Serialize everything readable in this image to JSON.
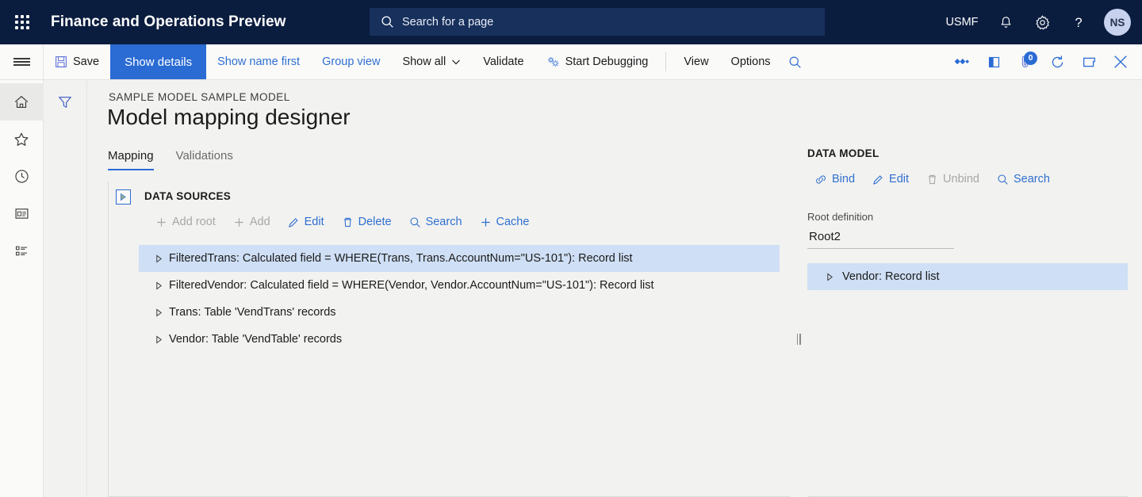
{
  "topbar": {
    "waffle_label": "app-launcher",
    "brand": "Finance and Operations Preview",
    "search_placeholder": "Search for a page",
    "company": "USMF",
    "notifications_icon": "bell-icon",
    "settings_icon": "gear-icon",
    "help_icon": "question-mark-icon",
    "avatar_initials": "NS"
  },
  "toolbar": {
    "save_label": "Save",
    "show_details_label": "Show details",
    "show_name_first_label": "Show name first",
    "group_view_label": "Group view",
    "show_all_label": "Show all",
    "validate_label": "Validate",
    "start_debugging_label": "Start Debugging",
    "view_label": "View",
    "options_label": "Options",
    "search_icon": "search-icon",
    "right_icons": {
      "related_icon": "diamond-cluster-icon",
      "panel_icon": "side-panel-icon",
      "attachments_icon": "attachment-icon",
      "attachments_badge": "0",
      "refresh_icon": "refresh-icon",
      "popout_icon": "open-in-new-window-icon",
      "close_icon": "close-icon"
    }
  },
  "rail": {
    "hamburger": "navigation-menu-icon",
    "items": [
      {
        "name": "home",
        "icon": "home-icon",
        "selected": true
      },
      {
        "name": "favorites",
        "icon": "star-icon",
        "selected": false
      },
      {
        "name": "recent",
        "icon": "clock-icon",
        "selected": false
      },
      {
        "name": "workspaces",
        "icon": "workspace-icon",
        "selected": false
      },
      {
        "name": "modules",
        "icon": "list-icon",
        "selected": false
      }
    ]
  },
  "filterstrip": {
    "filter_icon": "funnel-filter-icon"
  },
  "page": {
    "breadcrumb": "SAMPLE MODEL SAMPLE MODEL",
    "title": "Model mapping designer",
    "tabs": [
      {
        "label": "Mapping",
        "selected": true
      },
      {
        "label": "Validations",
        "selected": false
      }
    ]
  },
  "data_sources": {
    "expander_icon": "expand-panel-icon",
    "header": "DATA SOURCES",
    "commands": [
      {
        "label": "Add root",
        "icon": "plus-icon",
        "disabled": true
      },
      {
        "label": "Add",
        "icon": "plus-icon",
        "disabled": true
      },
      {
        "label": "Edit",
        "icon": "pencil-icon",
        "disabled": false
      },
      {
        "label": "Delete",
        "icon": "trash-icon",
        "disabled": false
      },
      {
        "label": "Search",
        "icon": "search-icon",
        "disabled": false
      },
      {
        "label": "Cache",
        "icon": "plus-icon",
        "disabled": false
      }
    ],
    "tree": [
      {
        "label": "FilteredTrans: Calculated field = WHERE(Trans, Trans.AccountNum=\"US-101\"): Record list",
        "selected": true
      },
      {
        "label": "FilteredVendor: Calculated field = WHERE(Vendor, Vendor.AccountNum=\"US-101\"): Record list",
        "selected": false
      },
      {
        "label": "Trans: Table 'VendTrans' records",
        "selected": false
      },
      {
        "label": "Vendor: Table 'VendTable' records",
        "selected": false
      }
    ]
  },
  "data_model": {
    "header": "DATA MODEL",
    "commands": [
      {
        "label": "Bind",
        "icon": "link-icon",
        "disabled": false
      },
      {
        "label": "Edit",
        "icon": "pencil-icon",
        "disabled": false
      },
      {
        "label": "Unbind",
        "icon": "trash-icon",
        "disabled": true
      },
      {
        "label": "Search",
        "icon": "search-icon",
        "disabled": false
      }
    ],
    "root_definition_label": "Root definition",
    "root_definition_value": "Root2",
    "tree": [
      {
        "label": "Vendor: Record list",
        "selected": true
      }
    ]
  },
  "colors": {
    "nav_bg": "#0b1d3f",
    "accent": "#2a6bd4",
    "link": "#2f6fd0",
    "selection": "#cfdff5",
    "page_bg": "#f2f2f0",
    "disabled": "#a7a7a5"
  }
}
